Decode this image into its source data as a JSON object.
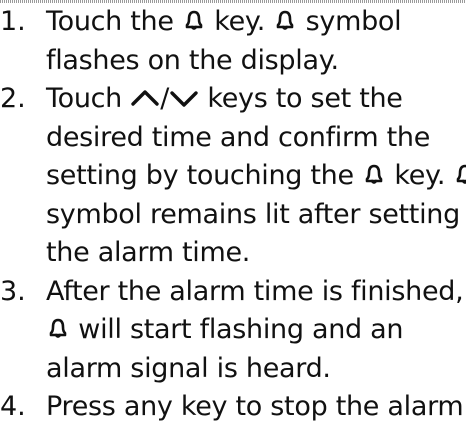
{
  "steps": [
    {
      "number": "1.",
      "lines": [
        [
          "Touch the ",
          {
            "icon": "bell-icon"
          },
          " key. ",
          {
            "icon": "bell-icon"
          },
          " symbol"
        ],
        [
          "flashes on the display."
        ]
      ]
    },
    {
      "number": "2.",
      "lines": [
        [
          "Touch ",
          {
            "icon": "chevron-up-icon"
          },
          "/",
          {
            "icon": "chevron-down-icon"
          },
          " keys to set the"
        ],
        [
          "desired time and confirm the"
        ],
        [
          "setting by touching the ",
          {
            "icon": "bell-icon"
          },
          " key. ",
          {
            "icon": "bell-icon"
          }
        ],
        [
          "symbol remains lit after setting"
        ],
        [
          "the alarm time."
        ]
      ]
    },
    {
      "number": "3.",
      "lines": [
        [
          "After the alarm time is finished,"
        ],
        [
          {
            "icon": "bell-icon"
          },
          " will start flashing and an"
        ],
        [
          "alarm signal is heard."
        ]
      ]
    },
    {
      "number": "4.",
      "lines": [
        [
          "Press any key to stop the alarm."
        ]
      ]
    }
  ]
}
